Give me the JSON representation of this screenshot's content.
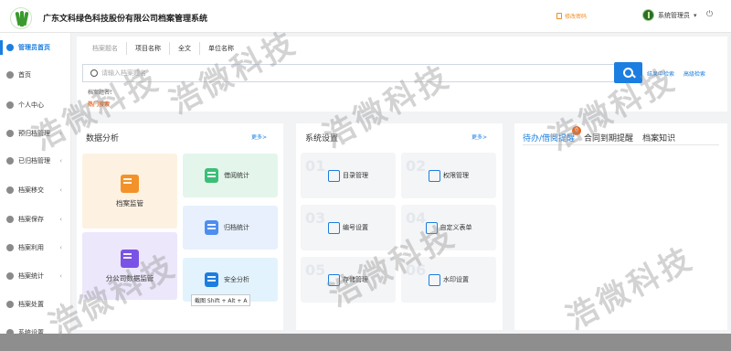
{
  "header": {
    "title": "广东文科绿色科技股份有限公司档案管理系统",
    "change_password": "修改密码",
    "user_name": "系统管理员"
  },
  "sidebar": {
    "items": [
      {
        "label": "管理员首页",
        "arrow": ""
      },
      {
        "label": "首页",
        "arrow": ""
      },
      {
        "label": "个人中心",
        "arrow": ""
      },
      {
        "label": "预归档管理",
        "arrow": "‹"
      },
      {
        "label": "已归档管理",
        "arrow": "‹"
      },
      {
        "label": "档案移交",
        "arrow": "‹"
      },
      {
        "label": "档案保存",
        "arrow": "‹"
      },
      {
        "label": "档案利用",
        "arrow": "‹"
      },
      {
        "label": "档案统计",
        "arrow": "‹"
      },
      {
        "label": "档案处置",
        "arrow": "‹"
      },
      {
        "label": "系统设置",
        "arrow": "‹"
      }
    ]
  },
  "search": {
    "tabs": [
      "档案题名",
      "项目名称",
      "全文",
      "单位名称"
    ],
    "placeholder": "请输入档案题名",
    "link_result": "结果中检索",
    "link_advanced": "高级检索",
    "title_label": "档案题名：",
    "hot_search": "热门搜索"
  },
  "data_analysis": {
    "title": "数据分析",
    "more": "更多>",
    "tiles": [
      "档案监管",
      "借阅统计",
      "归档统计",
      "分公司数据监管",
      "安全分析"
    ]
  },
  "system_settings": {
    "title": "系统设置",
    "more": "更多>",
    "items": [
      {
        "num": "01",
        "label": "目录管理"
      },
      {
        "num": "02",
        "label": "权限管理"
      },
      {
        "num": "03",
        "label": "编号设置"
      },
      {
        "num": "04",
        "label": "自定义表单"
      },
      {
        "num": "05",
        "label": "存储管理"
      },
      {
        "num": "06",
        "label": "水印设置"
      }
    ]
  },
  "todo": {
    "tabs": [
      "待办/借阅提醒",
      "合同到期提醒",
      "档案知识"
    ],
    "badge": "0"
  },
  "tooltip": "截图 Shift + Alt + A",
  "watermark": "浩微科技",
  "colors": {
    "accent": "#1c7ee0",
    "highlight": "#e8661e",
    "brand_green": "#3a9a2e"
  }
}
